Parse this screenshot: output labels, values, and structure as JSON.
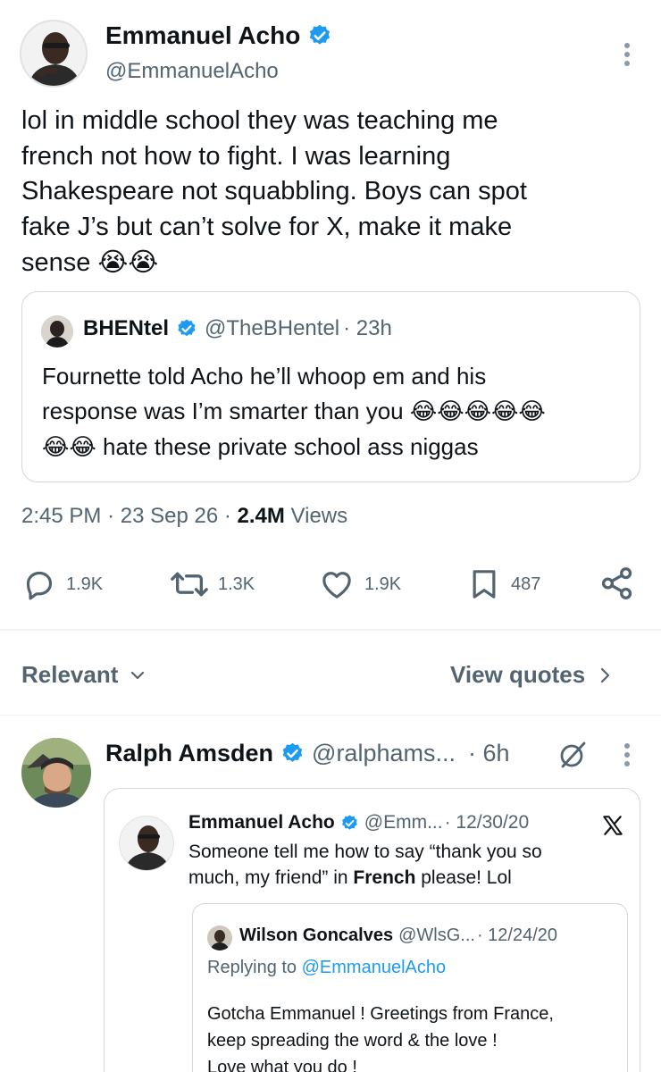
{
  "main_tweet": {
    "author_name": "Emmanuel Acho",
    "author_handle": "@EmmanuelAcho",
    "text_lines": [
      "lol in middle school they was teaching me",
      "french not how to fight. I was learning",
      "Shakespeare not squabbling. Boys can spot",
      "fake J’s but can’t solve for X, make it make",
      "sense"
    ],
    "text_emoji": "😭😭",
    "quoted": {
      "author_name": "BHENtel",
      "author_handle": "@TheBHentel",
      "time": "· 23h",
      "line1": "Fournette told Acho he’ll whoop em and his",
      "line2_text": "response was I’m smarter than you",
      "line2_emoji": "😂😂😂😂😂",
      "line3_emoji": "😂😂",
      "line3_text": "hate these private school ass niggas"
    },
    "time": "2:45 PM",
    "date": "23 Sep 26",
    "views_count": "2.4M",
    "views_label": "Views",
    "actions": {
      "replies": "1.9K",
      "reposts": "1.3K",
      "likes": "1.9K",
      "bookmarks": "487"
    }
  },
  "replies_header": {
    "sort_label": "Relevant",
    "view_quotes_label": "View quotes"
  },
  "reply": {
    "author_name": "Ralph Amsden",
    "author_handle": "@ralphams...",
    "time": "· 6h",
    "embedded": {
      "author_name": "Emmanuel Acho",
      "author_handle": "@Emm...",
      "date": "· 12/30/20",
      "line1": "Someone tell me how to say “thank you so",
      "line2_a": "much, my friend” in ",
      "line2_bold": "French",
      "line2_b": " please! Lol",
      "nested": {
        "author_name": "Wilson Goncalves",
        "author_handle": "@WlsG...",
        "date": "· 12/24/20",
        "replying_prefix": "Replying to ",
        "replying_handle": "@EmmanuelAcho",
        "lines": [
          "Gotcha Emmanuel ! Greetings from France,",
          "keep spreading the word & the love !",
          "Love what you do !"
        ]
      }
    }
  },
  "colors": {
    "accent": "#1d9bf0",
    "text": "#0f1419",
    "secondary": "#536471",
    "border": "#cfd9de"
  }
}
